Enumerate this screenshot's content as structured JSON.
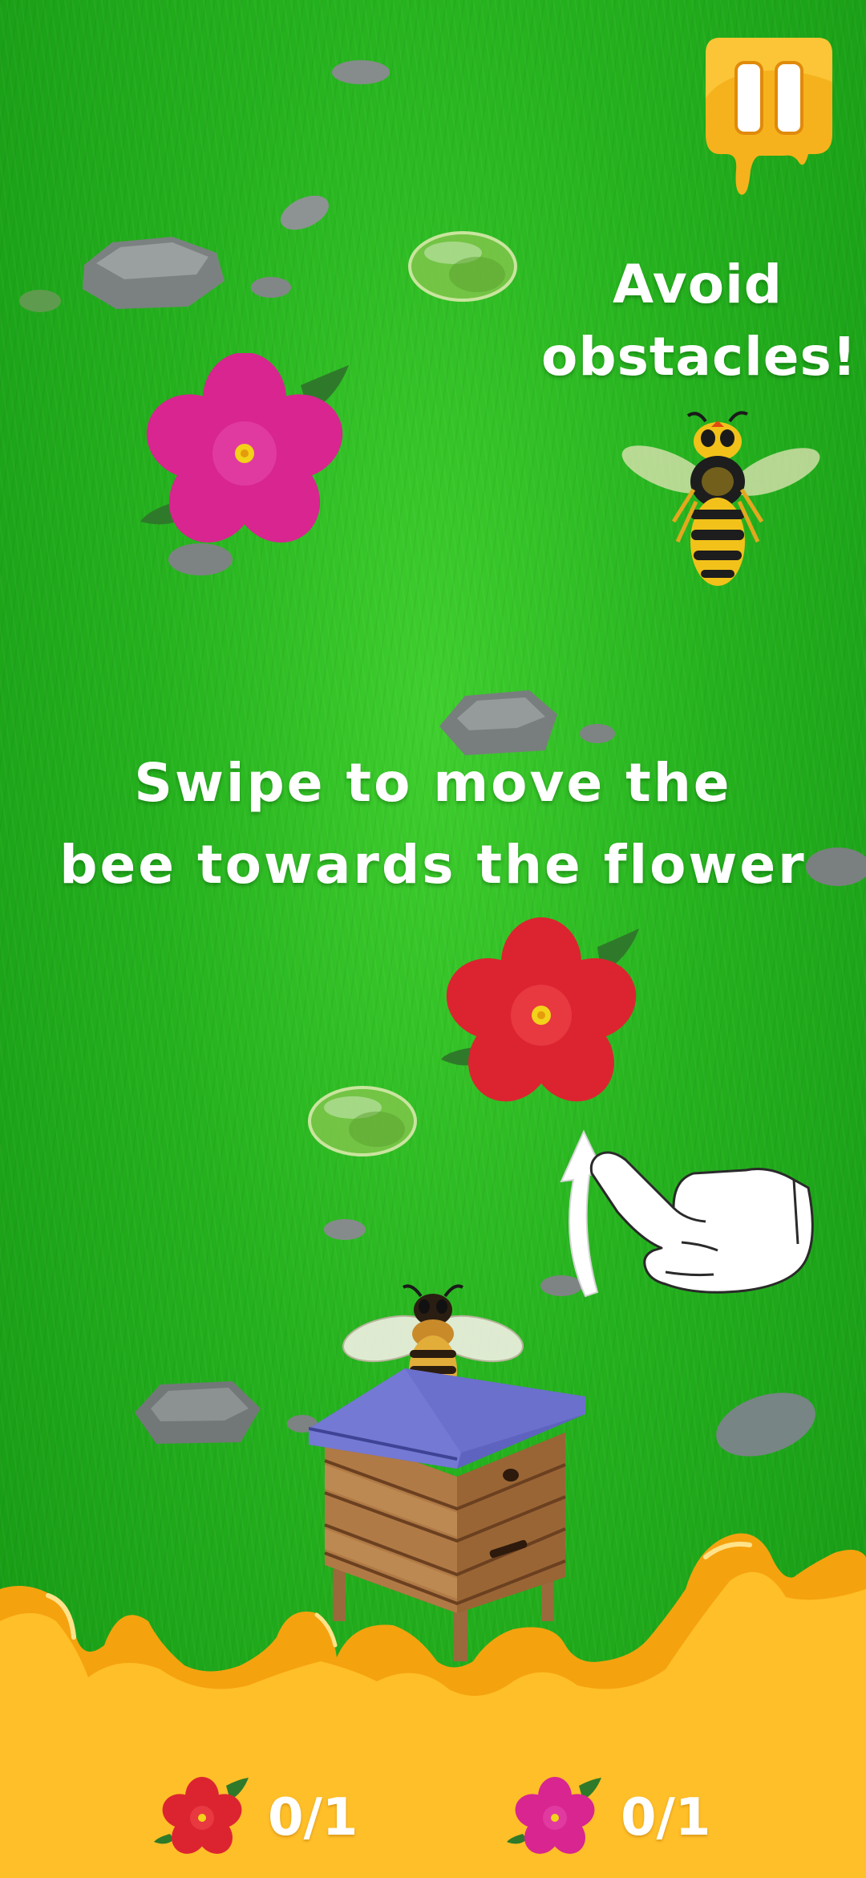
{
  "hints": {
    "avoid_line1": "Avoid",
    "avoid_line2": "obstacles!",
    "swipe_line1": "Swipe to move the",
    "swipe_line2": "bee towards the flower"
  },
  "hud": {
    "red_flower_count": "0/1",
    "pink_flower_count": "0/1"
  },
  "colors": {
    "grass": "#25b21e",
    "honey": "#f5a20f",
    "red_flower": "#e0262e",
    "pink_flower": "#e0259a",
    "hive_roof": "#6e74cf"
  },
  "icons": {
    "pause": "pause-icon",
    "swipe_hand": "hand-swipe-icon"
  }
}
